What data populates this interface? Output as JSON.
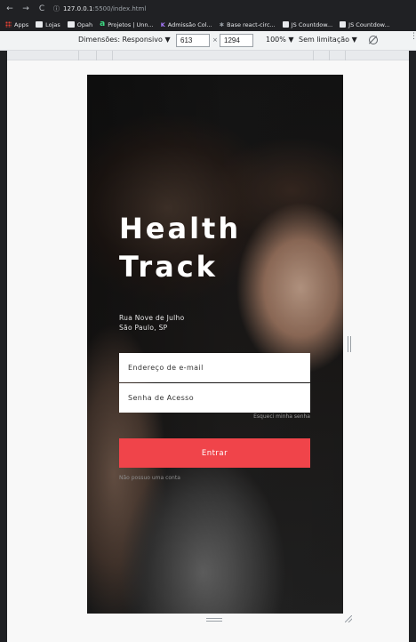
{
  "browser": {
    "url_host": "127.0.0.1",
    "url_path": ":5500/index.html",
    "bookmarks": [
      {
        "label": "Apps",
        "icon": "apps-icon"
      },
      {
        "label": "Lojas",
        "icon": "folder-icon"
      },
      {
        "label": "Opah",
        "icon": "folder-icon"
      },
      {
        "label": "Projetos | Unn...",
        "icon": "amazon-icon"
      },
      {
        "label": "Admissão Col...",
        "icon": "kotlin-icon"
      },
      {
        "label": "Base react-circ...",
        "icon": "star-icon"
      },
      {
        "label": "JS Countdow...",
        "icon": "page-icon"
      },
      {
        "label": "JS Countdow...",
        "icon": "page-icon"
      }
    ]
  },
  "devtools": {
    "dimensions_label": "Dimensões: Responsivo ▼",
    "width": "613",
    "times": "×",
    "height": "1294",
    "zoom": "100% ▼",
    "throttle": "Sem limitação ▼"
  },
  "app": {
    "title_line1": "Health",
    "title_line2": "Track",
    "address_line1": "Rua Nove de Julho",
    "address_line2": "São Paulo, SP",
    "email_placeholder": "Endereço de e-mail",
    "password_placeholder": "Senha de Acesso",
    "forgot_label": "Esqueci minha senha",
    "enter_label": "Entrar",
    "no_account_label": "Não possuo uma conta",
    "accent_color": "#f0444a"
  }
}
